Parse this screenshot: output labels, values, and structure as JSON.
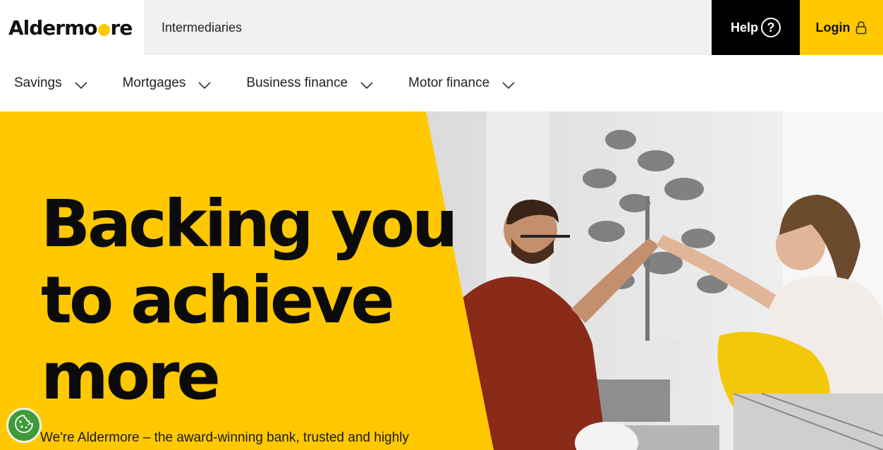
{
  "header": {
    "logo_text_pre": "Aldermore",
    "logo_text_post": "re",
    "logo_text_start": "Aldermo",
    "intermediaries_label": "Intermediaries",
    "help_label": "Help",
    "help_icon_glyph": "?",
    "login_label": "Login"
  },
  "nav": {
    "items": [
      {
        "label": "Savings"
      },
      {
        "label": "Mortgages"
      },
      {
        "label": "Business finance"
      },
      {
        "label": "Motor finance"
      }
    ]
  },
  "hero": {
    "headline_line1": "Backing you",
    "headline_line2": "to achieve",
    "headline_line3": "more",
    "subtext": "We're Aldermore – the award-winning bank, trusted and highly"
  },
  "colors": {
    "brand_yellow": "#ffc800",
    "black": "#000000",
    "cookie_green": "#3f9a3a"
  },
  "icons": [
    "question-circle-icon",
    "lock-icon",
    "chevron-down-icon",
    "cookie-icon"
  ]
}
